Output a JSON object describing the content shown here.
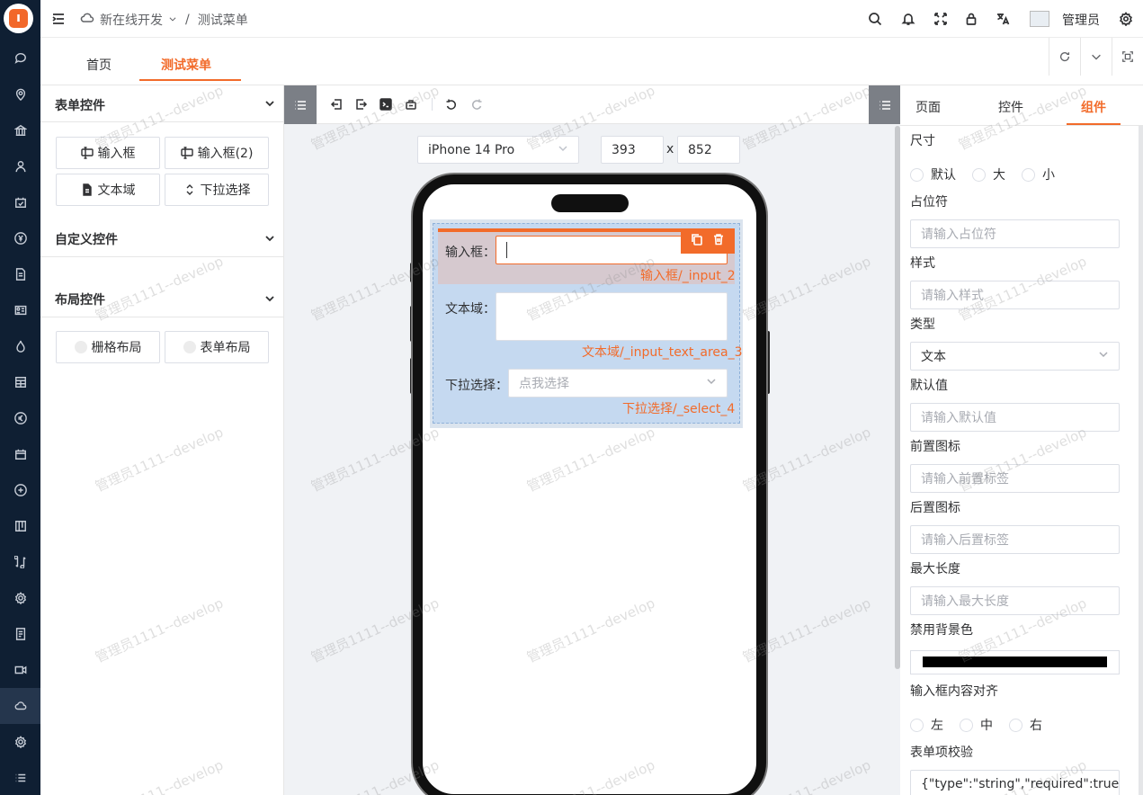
{
  "app": {
    "logo_letter": "ı",
    "brand_color": "#f26b2a"
  },
  "sidebar": {
    "icons": [
      "chat-icon",
      "location-icon",
      "bank-icon",
      "user-icon",
      "calendar-check-icon",
      "yen-icon",
      "document-icon",
      "id-card-icon",
      "fire-icon",
      "table-icon",
      "euro-icon",
      "calendar-icon",
      "currency-icon",
      "board-icon",
      "transfer-icon",
      "settings-icon",
      "report-icon",
      "video-icon",
      "cloud-icon",
      "gear-icon",
      "list-icon"
    ],
    "active": "cloud-icon"
  },
  "header": {
    "breadcrumb_root": "新在线开发",
    "breadcrumb_sep": "/",
    "breadcrumb_current": "测试菜单",
    "username": "管理员"
  },
  "tabs": {
    "home": "首页",
    "test": "测试菜单"
  },
  "left_panel": {
    "form_controls_title": "表单控件",
    "form_controls": [
      {
        "label": "输入框",
        "icon": "input-icon"
      },
      {
        "label": "输入框(2)",
        "icon": "input-icon"
      },
      {
        "label": "文本域",
        "icon": "file-icon"
      },
      {
        "label": "下拉选择",
        "icon": "sort-icon"
      }
    ],
    "custom_controls_title": "自定义控件",
    "layout_controls_title": "布局控件",
    "layout_controls": [
      {
        "label": "栅格布局"
      },
      {
        "label": "表单布局"
      }
    ]
  },
  "canvas": {
    "device": "iPhone 14 Pro",
    "width": "393",
    "x_label": "x",
    "height": "852",
    "form": {
      "input_label": "输入框：",
      "input_tag": "输入框/_input_2",
      "textarea_label": "文本域：",
      "textarea_tag": "文本域/_input_text_area_3",
      "select_label": "下拉选择：",
      "select_placeholder": "点我选择",
      "select_tag": "下拉选择/_select_4"
    }
  },
  "right_panel": {
    "tabs": {
      "page": "页面",
      "control": "控件",
      "component": "组件"
    },
    "size_label": "尺寸",
    "size_options": [
      "默认",
      "大",
      "小"
    ],
    "placeholder_label": "占位符",
    "placeholder_input": "请输入占位符",
    "style_label": "样式",
    "style_input": "请输入样式",
    "type_label": "类型",
    "type_value": "文本",
    "default_label": "默认值",
    "default_input": "请输入默认值",
    "prefix_label": "前置图标",
    "prefix_input": "请输入前置标签",
    "suffix_label": "后置图标",
    "suffix_input": "请输入后置标签",
    "maxlen_label": "最大长度",
    "maxlen_input": "请输入最大长度",
    "disabled_bg_label": "禁用背景色",
    "disabled_bg_color": "#000000",
    "align_label": "输入框内容对齐",
    "align_options": [
      "左",
      "中",
      "右"
    ],
    "validation_label": "表单项校验",
    "validation_value": "{\"type\":\"string\",\"required\":true,\""
  },
  "watermark": "管理员1111--develop"
}
